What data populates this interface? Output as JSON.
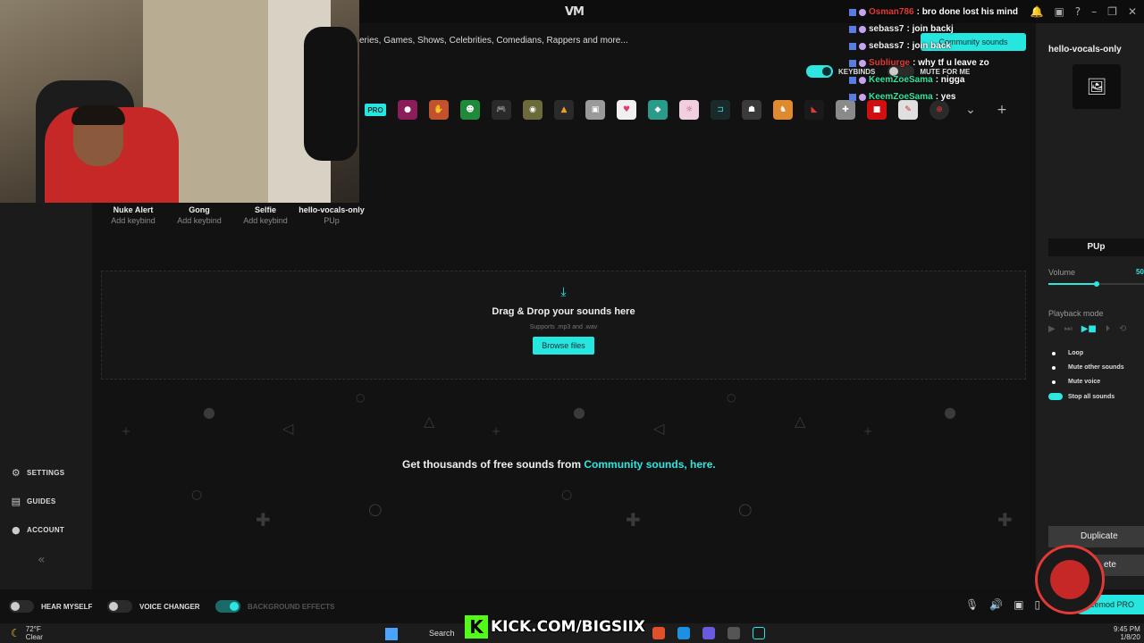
{
  "app": {
    "logo": "VM"
  },
  "window_controls": [
    "🔔",
    "▣",
    "?",
    "–",
    "❐",
    "✕"
  ],
  "search": {
    "placeholder_text": "eries, Games, Shows, Celebrities, Comedians, Rappers and more..."
  },
  "community_sounds_button": "Community sounds",
  "toggles": {
    "keybinds": "KEYBINDS",
    "mute_for_me": "MUTE FOR ME"
  },
  "categories": {
    "pro": "PRO",
    "icons": [
      "●",
      "✋",
      "☻",
      "🎮",
      "◉",
      "▲",
      "▣",
      "♥",
      "◆",
      "☼",
      "⊐",
      "☗",
      "♞",
      "◣",
      "✚",
      "■",
      "✎",
      "⊕"
    ],
    "more": "⌄",
    "add": "+"
  },
  "sounds": [
    {
      "name": "Nuke Alert",
      "keybind": "Add keybind"
    },
    {
      "name": "Gong",
      "keybind": "Add keybind"
    },
    {
      "name": "Selfie",
      "keybind": "Add keybind"
    },
    {
      "name": "hello-vocals-only",
      "keybind": "PUp"
    }
  ],
  "sidebar": {
    "settings": "SETTINGS",
    "guides": "GUIDES",
    "account": "ACCOUNT",
    "collapse": "«"
  },
  "dropzone": {
    "icon": "⤓",
    "title": "Drag & Drop your sounds here",
    "subtitle": "Supports .mp3 and .wav",
    "button": "Browse files"
  },
  "community_line": {
    "text": "Get thousands of free sounds from ",
    "link": "Community sounds, here."
  },
  "right_panel": {
    "title": "hello-vocals-only",
    "image_icon": "🖼",
    "keybind": "PUp",
    "volume_label": "Volume",
    "volume_value": "50",
    "playback_label": "Playback mode",
    "playback_modes": [
      "▶",
      "⏭",
      "▶■",
      "⏵",
      "⟲"
    ],
    "options": {
      "loop": "Loop",
      "mute_other": "Mute other sounds",
      "mute_voice": "Mute voice",
      "stop_all": "Stop all sounds"
    },
    "duplicate": "Duplicate",
    "delete": "ete"
  },
  "chat": [
    {
      "user": "Osman786",
      "text": ": bro done lost his mind",
      "color": "#e53935"
    },
    {
      "user": "sebass7",
      "text": ": join backj",
      "color": "#eeeeee"
    },
    {
      "user": "sebass7",
      "text": ": join back",
      "color": "#eeeeee"
    },
    {
      "user": "Subliurge",
      "text": ": why tf u leave zo",
      "color": "#e53935"
    },
    {
      "user": "KeemZoeSama",
      "text": ": nigga",
      "color": "#2ee6a0"
    },
    {
      "user": "KeemZoeSama",
      "text": ": yes",
      "color": "#2ee6a0"
    }
  ],
  "bottom_bar": {
    "hear_myself": "HEAR MYSELF",
    "voice_changer": "VOICE CHANGER",
    "background_effects": "BACKGROUND EFFECTS",
    "upgrade": "cemod PRO"
  },
  "taskbar": {
    "temp": "72°F",
    "condition": "Clear",
    "search": "Search",
    "time": "9:45 PM",
    "date": "1/8/20"
  },
  "kick_overlay": {
    "text": "KICK.COM/BIGSIIX"
  },
  "colors": {
    "accent": "#2ee6e0",
    "background": "#121212"
  }
}
